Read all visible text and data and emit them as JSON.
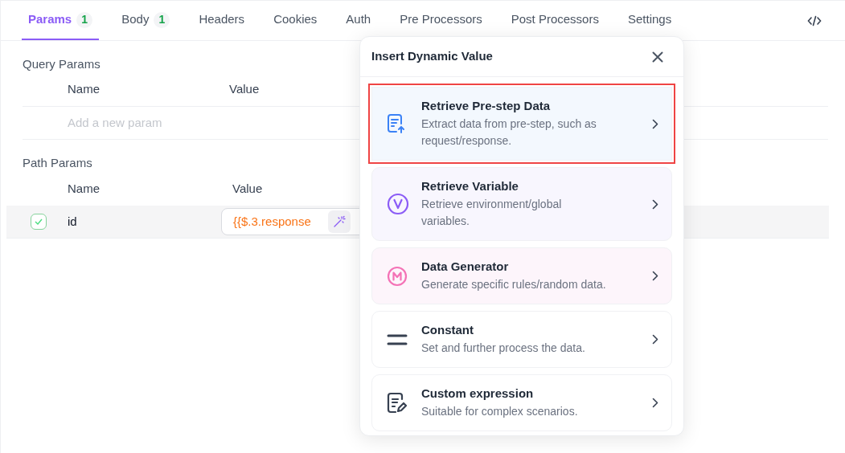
{
  "tabs": [
    {
      "label": "Params",
      "badge": "1",
      "selected": true
    },
    {
      "label": "Body",
      "badge": "1",
      "selected": false
    },
    {
      "label": "Headers",
      "selected": false
    },
    {
      "label": "Cookies",
      "selected": false
    },
    {
      "label": "Auth",
      "selected": false
    },
    {
      "label": "Pre Processors",
      "selected": false
    },
    {
      "label": "Post Processors",
      "selected": false
    },
    {
      "label": "Settings",
      "selected": false
    }
  ],
  "query_params": {
    "title": "Query Params",
    "columns": [
      "Name",
      "Value"
    ],
    "placeholder": "Add a new param"
  },
  "path_params": {
    "title": "Path Params",
    "columns": [
      "Name",
      "Value"
    ],
    "rows": [
      {
        "checked": true,
        "name": "id",
        "value": "{{$.3.response"
      }
    ]
  },
  "popup": {
    "title": "Insert Dynamic Value",
    "items": [
      {
        "kind": "prestep",
        "title": "Retrieve Pre-step Data",
        "description": "Extract data from pre-step, such as request/response.",
        "selected": true
      },
      {
        "kind": "variable",
        "title": "Retrieve Variable",
        "description": "Retrieve environment/global variables.",
        "selected": false
      },
      {
        "kind": "generator",
        "title": "Data Generator",
        "description": "Generate specific rules/random data.",
        "selected": false
      },
      {
        "kind": "constant",
        "title": "Constant",
        "description": "Set and further process the data.",
        "selected": false
      },
      {
        "kind": "expression",
        "title": "Custom expression",
        "description": "Suitable for complex scenarios.",
        "selected": false
      }
    ]
  }
}
